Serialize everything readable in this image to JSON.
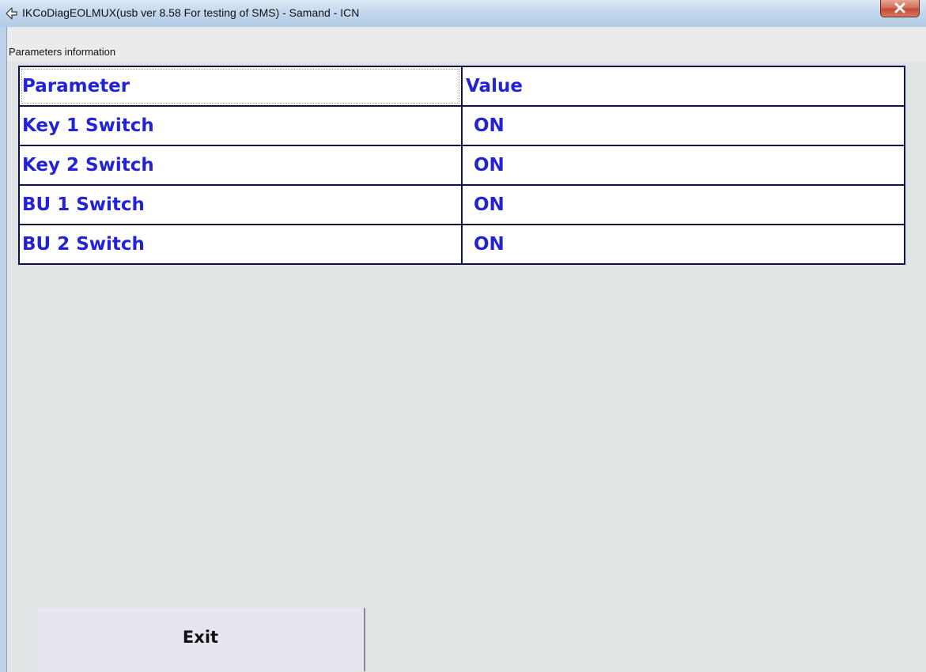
{
  "window": {
    "title": "IKCoDiagEOLMUX(usb ver 8.58 For testing of SMS)  - Samand - ICN",
    "app_icon": "arrow-logo-icon",
    "close_icon": "close-icon"
  },
  "subheader": {
    "label": "Parameters information"
  },
  "table": {
    "headers": {
      "parameter": "Parameter",
      "value": "Value"
    },
    "rows": [
      {
        "parameter": "Key 1 Switch",
        "value": "ON"
      },
      {
        "parameter": "Key 2 Switch",
        "value": "ON"
      },
      {
        "parameter": "BU 1 Switch",
        "value": "ON"
      },
      {
        "parameter": "BU 2 Switch",
        "value": "ON"
      }
    ]
  },
  "buttons": {
    "exit_label": "Exit"
  },
  "colors": {
    "cell_text": "#2323d6",
    "grid_border": "#0f0f4a",
    "client_bg": "#e1e4e4",
    "close_button": "#c24a36"
  }
}
